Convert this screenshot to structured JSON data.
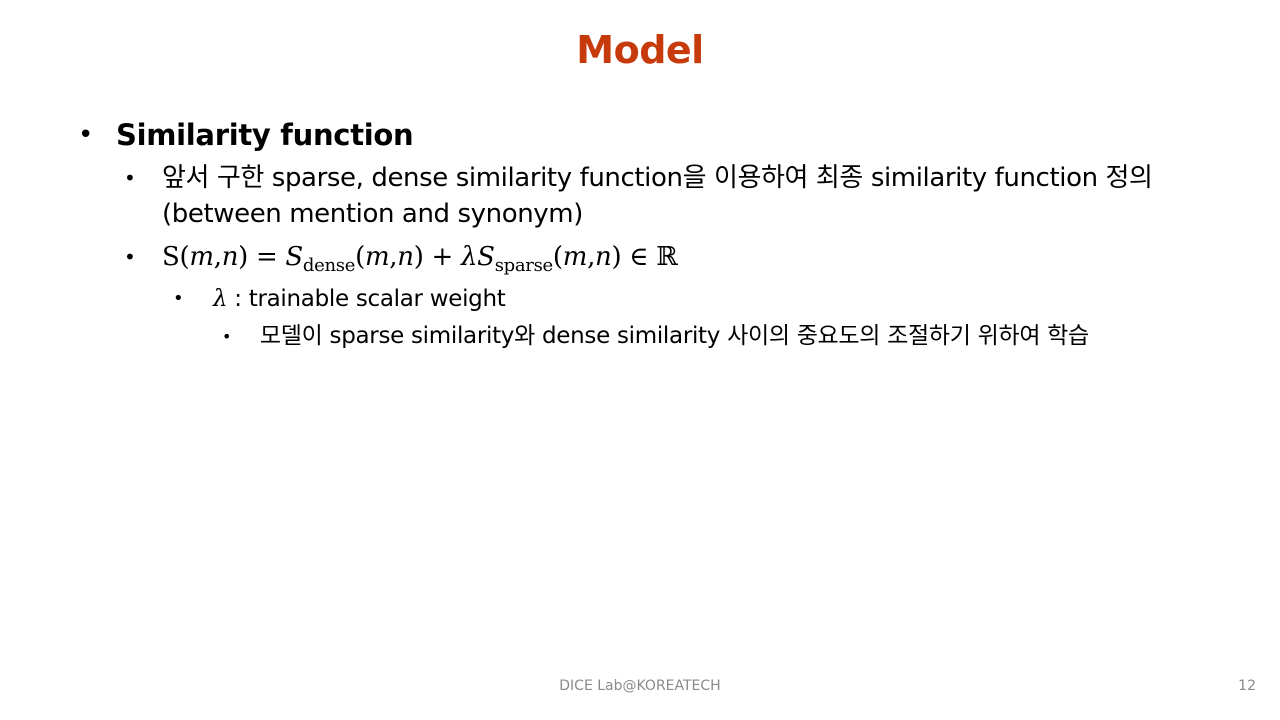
{
  "slide": {
    "title": "Model",
    "footer": "DICE Lab@KOREATECH",
    "page_number": "12"
  },
  "bullets": {
    "heading": "Similarity function",
    "definition": "앞서 구한 sparse, dense similarity function을 이용하여 최종 similarity function 정의(between mention and synonym)",
    "formula": {
      "lhs_S": "S",
      "lhs_args_open": "(",
      "m": "m",
      "comma": ",",
      "n": "n",
      "lhs_args_close": ")",
      "equals": " = ",
      "S_dense": "S",
      "dense_sub": "dense",
      "plus": " + ",
      "lambda": "λ",
      "S_sparse": "S",
      "sparse_sub": "sparse",
      "member": " ∈ ",
      "reals": "ℝ"
    },
    "lambda_symbol": "λ",
    "lambda_desc": " : trainable scalar weight",
    "lambda_detail": "모델이 sparse similarity와 dense similarity 사이의 중요도의 조절하기 위하여 학습"
  },
  "bullet_char": "•",
  "colors": {
    "title": "#c63a0c",
    "footer": "#8a8a8a",
    "text": "#000000"
  }
}
